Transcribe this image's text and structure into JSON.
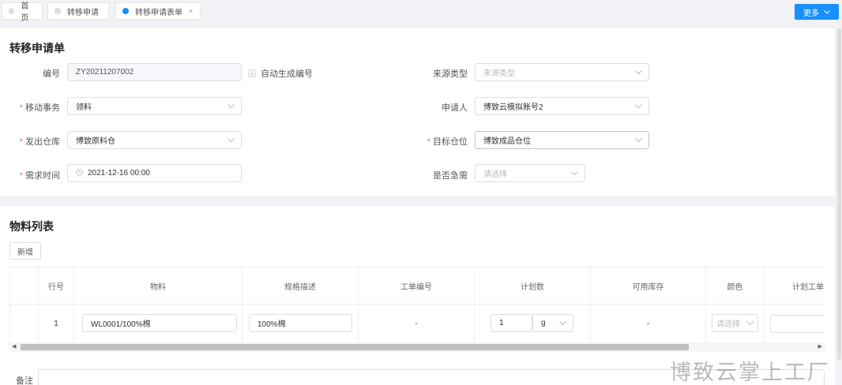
{
  "tabs": [
    {
      "label": "首页",
      "active": false,
      "closable": false
    },
    {
      "label": "转移申请",
      "active": false,
      "closable": false
    },
    {
      "label": "转移申请表单",
      "active": true,
      "closable": true
    }
  ],
  "tab_close_glyph": "×",
  "more_button": {
    "label": "更多",
    "icon": "chevron-down-icon"
  },
  "form": {
    "title": "转移申请单",
    "code": {
      "label": "编号",
      "value": "ZY20211207002"
    },
    "auto_generate": {
      "label": "自动生成编号",
      "checked": true
    },
    "source_type": {
      "label": "来源类型",
      "placeholder": "来源类型"
    },
    "move_affair": {
      "label": "移动事务",
      "value": "领料",
      "required": true
    },
    "applicant": {
      "label": "申请人",
      "value": "博致云模拟账号2"
    },
    "from_warehouse": {
      "label": "发出仓库",
      "value": "博致原料仓",
      "required": true
    },
    "target_location": {
      "label": "目标仓位",
      "value": "博致成品仓位",
      "required": true
    },
    "need_time": {
      "label": "需求时间",
      "value": "2021-12-16 00:00",
      "required": true
    },
    "urgent": {
      "label": "是否急需",
      "placeholder": "请选择"
    }
  },
  "materials": {
    "title": "物料列表",
    "add_label": "新增",
    "columns": [
      "行号",
      "物料",
      "规格描述",
      "工单编号",
      "计划数",
      "可用库存",
      "颜色",
      "计划工单"
    ],
    "rows": [
      {
        "line_no": "1",
        "material": "WL0001/100%棉",
        "spec": "100%棉",
        "work_order": "-",
        "plan_qty": "1",
        "unit": "g",
        "stock": "-",
        "color_placeholder": "请选择"
      }
    ]
  },
  "remark_label": "备注",
  "watermark": "博致云掌上工厂",
  "colors": {
    "accent": "#1890ff",
    "required": "#f56c6c"
  }
}
